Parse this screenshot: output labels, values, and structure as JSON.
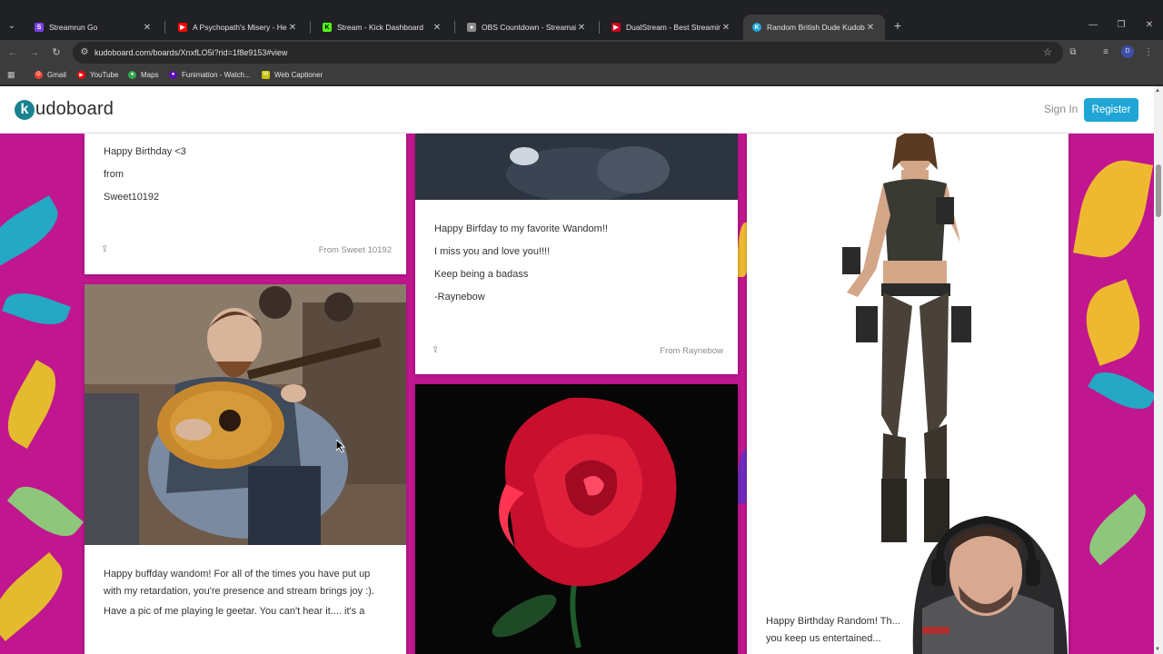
{
  "browser": {
    "tabs": [
      {
        "title": "Streamrun Go",
        "icon": "streamrun-icon",
        "color": "#7b3fe4",
        "glyph": "S"
      },
      {
        "title": "A Psychopath's Misery - Heartb...",
        "icon": "youtube-icon",
        "color": "#ff0000",
        "glyph": "▶"
      },
      {
        "title": "Stream - Kick Dashboard",
        "icon": "kick-icon",
        "color": "#53fc18",
        "glyph": "K"
      },
      {
        "title": "OBS Countdown - Streamable f...",
        "icon": "obs-icon",
        "color": "#8a8a8a",
        "glyph": "●"
      },
      {
        "title": "DualStream - Best Streaming Ap...",
        "icon": "dualstream-icon",
        "color": "#d0021b",
        "glyph": "▶"
      },
      {
        "title": "Random British Dude Kudoboard",
        "icon": "kudoboard-icon",
        "color": "#1fa6d6",
        "glyph": "K"
      }
    ],
    "url": "kudoboard.com/boards/XnxfLO5i?rid=1f8e9153#view",
    "profile_initial": "D",
    "bookmarks": [
      {
        "label": "Gmail",
        "icon": "gmail-icon",
        "color": "#ea4335",
        "glyph": "G"
      },
      {
        "label": "YouTube",
        "icon": "youtube-icon",
        "color": "#ff0000",
        "glyph": "▶"
      },
      {
        "label": "Maps",
        "icon": "maps-icon",
        "color": "#34a853",
        "glyph": "●"
      },
      {
        "label": "Funimation - Watch...",
        "icon": "funimation-icon",
        "color": "#5b0bb5",
        "glyph": "●"
      },
      {
        "label": "Web Captioner",
        "icon": "webcaptioner-icon",
        "color": "#c9c200",
        "glyph": "W"
      }
    ]
  },
  "site": {
    "logo_letter": "k",
    "logo_text": "udoboard",
    "sign_in": "Sign In",
    "register": "Register",
    "accent": "#1fa6d6",
    "background": "#c0168f"
  },
  "cards": {
    "sweet": {
      "lines": [
        "Happy Birthday <3",
        "from",
        "Sweet10192"
      ],
      "from": "From Sweet 10192"
    },
    "raynebow": {
      "lines": [
        "Happy Birfday to my favorite Wandom!!",
        "I miss you and love you!!!!",
        "Keep being a badass",
        "-Raynebow"
      ],
      "from": "From Raynebow"
    },
    "guitar": {
      "lines": [
        "Happy buffday wandom! For all of the times you have put up with my retardation, you're presence and stream brings joy :).",
        "Have a pic of me playing le geetar. You can't hear it.... it's a"
      ]
    },
    "lara": {
      "lines": [
        "Happy Birthday Random! Th...",
        "you keep us entertained..."
      ]
    }
  }
}
